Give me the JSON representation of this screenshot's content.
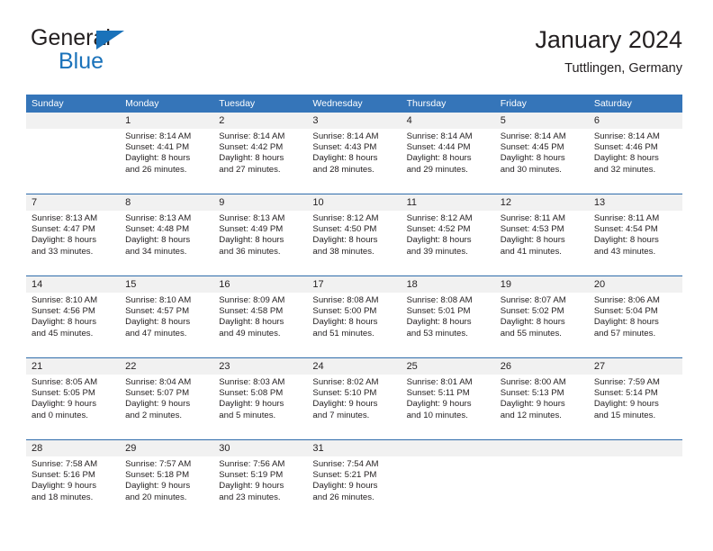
{
  "brand": {
    "name_top": "General",
    "name_bottom": "Blue",
    "triangle_color": "#1a72ba"
  },
  "header": {
    "title": "January 2024",
    "subtitle": "Tuttlingen, Germany"
  },
  "theme": {
    "header_bar": "#3575b9",
    "week_rule": "#2f6cab",
    "number_band": "#f1f1f1",
    "text": "#231f20"
  },
  "calendar": {
    "weekdays": [
      "Sunday",
      "Monday",
      "Tuesday",
      "Wednesday",
      "Thursday",
      "Friday",
      "Saturday"
    ],
    "weeks": [
      [
        {
          "day": "",
          "sunrise": "",
          "sunset": "",
          "daylight_line1": "",
          "daylight_line2": ""
        },
        {
          "day": "1",
          "sunrise": "Sunrise: 8:14 AM",
          "sunset": "Sunset: 4:41 PM",
          "daylight_line1": "Daylight: 8 hours",
          "daylight_line2": "and 26 minutes."
        },
        {
          "day": "2",
          "sunrise": "Sunrise: 8:14 AM",
          "sunset": "Sunset: 4:42 PM",
          "daylight_line1": "Daylight: 8 hours",
          "daylight_line2": "and 27 minutes."
        },
        {
          "day": "3",
          "sunrise": "Sunrise: 8:14 AM",
          "sunset": "Sunset: 4:43 PM",
          "daylight_line1": "Daylight: 8 hours",
          "daylight_line2": "and 28 minutes."
        },
        {
          "day": "4",
          "sunrise": "Sunrise: 8:14 AM",
          "sunset": "Sunset: 4:44 PM",
          "daylight_line1": "Daylight: 8 hours",
          "daylight_line2": "and 29 minutes."
        },
        {
          "day": "5",
          "sunrise": "Sunrise: 8:14 AM",
          "sunset": "Sunset: 4:45 PM",
          "daylight_line1": "Daylight: 8 hours",
          "daylight_line2": "and 30 minutes."
        },
        {
          "day": "6",
          "sunrise": "Sunrise: 8:14 AM",
          "sunset": "Sunset: 4:46 PM",
          "daylight_line1": "Daylight: 8 hours",
          "daylight_line2": "and 32 minutes."
        }
      ],
      [
        {
          "day": "7",
          "sunrise": "Sunrise: 8:13 AM",
          "sunset": "Sunset: 4:47 PM",
          "daylight_line1": "Daylight: 8 hours",
          "daylight_line2": "and 33 minutes."
        },
        {
          "day": "8",
          "sunrise": "Sunrise: 8:13 AM",
          "sunset": "Sunset: 4:48 PM",
          "daylight_line1": "Daylight: 8 hours",
          "daylight_line2": "and 34 minutes."
        },
        {
          "day": "9",
          "sunrise": "Sunrise: 8:13 AM",
          "sunset": "Sunset: 4:49 PM",
          "daylight_line1": "Daylight: 8 hours",
          "daylight_line2": "and 36 minutes."
        },
        {
          "day": "10",
          "sunrise": "Sunrise: 8:12 AM",
          "sunset": "Sunset: 4:50 PM",
          "daylight_line1": "Daylight: 8 hours",
          "daylight_line2": "and 38 minutes."
        },
        {
          "day": "11",
          "sunrise": "Sunrise: 8:12 AM",
          "sunset": "Sunset: 4:52 PM",
          "daylight_line1": "Daylight: 8 hours",
          "daylight_line2": "and 39 minutes."
        },
        {
          "day": "12",
          "sunrise": "Sunrise: 8:11 AM",
          "sunset": "Sunset: 4:53 PM",
          "daylight_line1": "Daylight: 8 hours",
          "daylight_line2": "and 41 minutes."
        },
        {
          "day": "13",
          "sunrise": "Sunrise: 8:11 AM",
          "sunset": "Sunset: 4:54 PM",
          "daylight_line1": "Daylight: 8 hours",
          "daylight_line2": "and 43 minutes."
        }
      ],
      [
        {
          "day": "14",
          "sunrise": "Sunrise: 8:10 AM",
          "sunset": "Sunset: 4:56 PM",
          "daylight_line1": "Daylight: 8 hours",
          "daylight_line2": "and 45 minutes."
        },
        {
          "day": "15",
          "sunrise": "Sunrise: 8:10 AM",
          "sunset": "Sunset: 4:57 PM",
          "daylight_line1": "Daylight: 8 hours",
          "daylight_line2": "and 47 minutes."
        },
        {
          "day": "16",
          "sunrise": "Sunrise: 8:09 AM",
          "sunset": "Sunset: 4:58 PM",
          "daylight_line1": "Daylight: 8 hours",
          "daylight_line2": "and 49 minutes."
        },
        {
          "day": "17",
          "sunrise": "Sunrise: 8:08 AM",
          "sunset": "Sunset: 5:00 PM",
          "daylight_line1": "Daylight: 8 hours",
          "daylight_line2": "and 51 minutes."
        },
        {
          "day": "18",
          "sunrise": "Sunrise: 8:08 AM",
          "sunset": "Sunset: 5:01 PM",
          "daylight_line1": "Daylight: 8 hours",
          "daylight_line2": "and 53 minutes."
        },
        {
          "day": "19",
          "sunrise": "Sunrise: 8:07 AM",
          "sunset": "Sunset: 5:02 PM",
          "daylight_line1": "Daylight: 8 hours",
          "daylight_line2": "and 55 minutes."
        },
        {
          "day": "20",
          "sunrise": "Sunrise: 8:06 AM",
          "sunset": "Sunset: 5:04 PM",
          "daylight_line1": "Daylight: 8 hours",
          "daylight_line2": "and 57 minutes."
        }
      ],
      [
        {
          "day": "21",
          "sunrise": "Sunrise: 8:05 AM",
          "sunset": "Sunset: 5:05 PM",
          "daylight_line1": "Daylight: 9 hours",
          "daylight_line2": "and 0 minutes."
        },
        {
          "day": "22",
          "sunrise": "Sunrise: 8:04 AM",
          "sunset": "Sunset: 5:07 PM",
          "daylight_line1": "Daylight: 9 hours",
          "daylight_line2": "and 2 minutes."
        },
        {
          "day": "23",
          "sunrise": "Sunrise: 8:03 AM",
          "sunset": "Sunset: 5:08 PM",
          "daylight_line1": "Daylight: 9 hours",
          "daylight_line2": "and 5 minutes."
        },
        {
          "day": "24",
          "sunrise": "Sunrise: 8:02 AM",
          "sunset": "Sunset: 5:10 PM",
          "daylight_line1": "Daylight: 9 hours",
          "daylight_line2": "and 7 minutes."
        },
        {
          "day": "25",
          "sunrise": "Sunrise: 8:01 AM",
          "sunset": "Sunset: 5:11 PM",
          "daylight_line1": "Daylight: 9 hours",
          "daylight_line2": "and 10 minutes."
        },
        {
          "day": "26",
          "sunrise": "Sunrise: 8:00 AM",
          "sunset": "Sunset: 5:13 PM",
          "daylight_line1": "Daylight: 9 hours",
          "daylight_line2": "and 12 minutes."
        },
        {
          "day": "27",
          "sunrise": "Sunrise: 7:59 AM",
          "sunset": "Sunset: 5:14 PM",
          "daylight_line1": "Daylight: 9 hours",
          "daylight_line2": "and 15 minutes."
        }
      ],
      [
        {
          "day": "28",
          "sunrise": "Sunrise: 7:58 AM",
          "sunset": "Sunset: 5:16 PM",
          "daylight_line1": "Daylight: 9 hours",
          "daylight_line2": "and 18 minutes."
        },
        {
          "day": "29",
          "sunrise": "Sunrise: 7:57 AM",
          "sunset": "Sunset: 5:18 PM",
          "daylight_line1": "Daylight: 9 hours",
          "daylight_line2": "and 20 minutes."
        },
        {
          "day": "30",
          "sunrise": "Sunrise: 7:56 AM",
          "sunset": "Sunset: 5:19 PM",
          "daylight_line1": "Daylight: 9 hours",
          "daylight_line2": "and 23 minutes."
        },
        {
          "day": "31",
          "sunrise": "Sunrise: 7:54 AM",
          "sunset": "Sunset: 5:21 PM",
          "daylight_line1": "Daylight: 9 hours",
          "daylight_line2": "and 26 minutes."
        },
        {
          "day": "",
          "sunrise": "",
          "sunset": "",
          "daylight_line1": "",
          "daylight_line2": ""
        },
        {
          "day": "",
          "sunrise": "",
          "sunset": "",
          "daylight_line1": "",
          "daylight_line2": ""
        },
        {
          "day": "",
          "sunrise": "",
          "sunset": "",
          "daylight_line1": "",
          "daylight_line2": ""
        }
      ]
    ]
  }
}
